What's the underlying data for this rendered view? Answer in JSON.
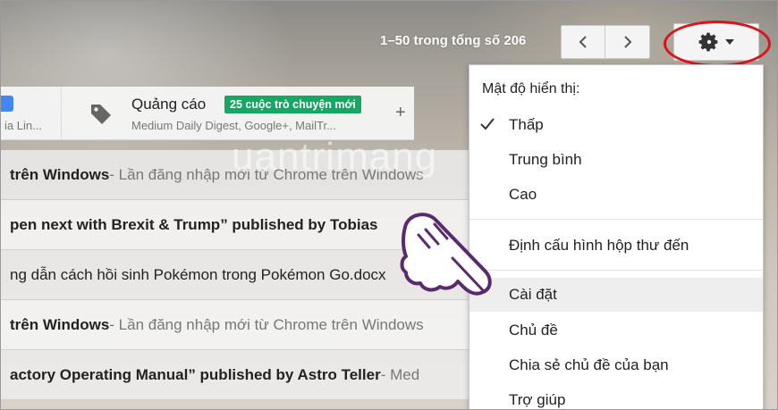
{
  "toolbar": {
    "counter": "1–50 trong tổng số 206",
    "prev_icon": "chevron-left-icon",
    "next_icon": "chevron-right-icon",
    "settings_icon": "gear-icon"
  },
  "tabs": {
    "primary_sub": "ia Lin...",
    "promotions_title": "Quảng cáo",
    "promotions_badge": "25 cuộc trò chuyện mới",
    "promotions_sub": "Medium Daily Digest, Google+, MailTr...",
    "add_tab": "+"
  },
  "emails": [
    {
      "subject": "trên Windows",
      "snippet": " - Lần đăng nhập mới từ Chrome trên Windows",
      "bold": true
    },
    {
      "subject": "pen next with Brexit & Trump” published by Tobias",
      "snippet": "",
      "bold": true
    },
    {
      "subject": "ng dẫn cách hồi sinh Pokémon trong Pokémon Go.docx",
      "snippet": "",
      "bold": false
    },
    {
      "subject": "trên Windows",
      "snippet": " - Lần đăng nhập mới từ Chrome trên Windows",
      "bold": true
    },
    {
      "subject": "actory Operating Manual” published by Astro Teller",
      "snippet": " - Med",
      "bold": true
    }
  ],
  "watermark": "uantrimang",
  "menu": {
    "density_header": "Mật độ hiển thị:",
    "density_low": "Thấp",
    "density_medium": "Trung bình",
    "density_high": "Cao",
    "configure_inbox": "Định cấu hình hộp thư đến",
    "settings": "Cài đặt",
    "themes": "Chủ đề",
    "share_theme": "Chia sẻ chủ đề của bạn",
    "help": "Trợ giúp"
  },
  "colors": {
    "highlight": "#d9141b",
    "badge": "#16a765",
    "hand": "#5a2a6e"
  }
}
